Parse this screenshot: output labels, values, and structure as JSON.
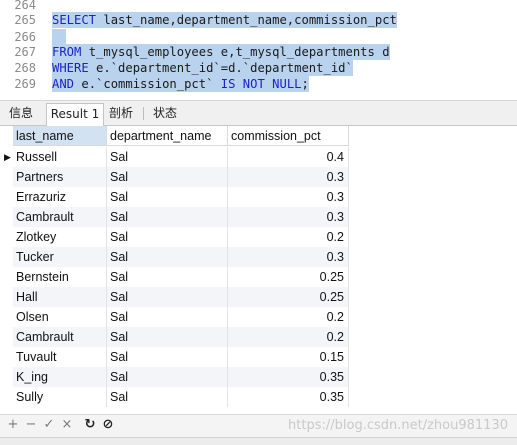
{
  "editor": {
    "lines": [
      {
        "num": "264",
        "code": ""
      },
      {
        "num": "265",
        "code": "SELECT last_name,department_name,commission_pct"
      },
      {
        "num": "266",
        "code": ""
      },
      {
        "num": "267",
        "code": "FROM t_mysql_employees e,t_mysql_departments d"
      },
      {
        "num": "268",
        "code": "WHERE e.`department_id`=d.`department_id`"
      },
      {
        "num": "269",
        "code": "AND e.`commission_pct` IS NOT NULL;"
      }
    ]
  },
  "tabs": [
    {
      "label": "信息",
      "active": false
    },
    {
      "label": "Result 1",
      "active": true
    },
    {
      "label": "剖析",
      "active": false
    },
    {
      "label": "状态",
      "active": false
    }
  ],
  "grid": {
    "columns": [
      "last_name",
      "department_name",
      "commission_pct"
    ],
    "rows": [
      [
        "Russell",
        "Sal",
        "0.4"
      ],
      [
        "Partners",
        "Sal",
        "0.3"
      ],
      [
        "Errazuriz",
        "Sal",
        "0.3"
      ],
      [
        "Cambrault",
        "Sal",
        "0.3"
      ],
      [
        "Zlotkey",
        "Sal",
        "0.2"
      ],
      [
        "Tucker",
        "Sal",
        "0.3"
      ],
      [
        "Bernstein",
        "Sal",
        "0.25"
      ],
      [
        "Hall",
        "Sal",
        "0.25"
      ],
      [
        "Olsen",
        "Sal",
        "0.2"
      ],
      [
        "Cambrault",
        "Sal",
        "0.2"
      ],
      [
        "Tuvault",
        "Sal",
        "0.15"
      ],
      [
        "K_ing",
        "Sal",
        "0.35"
      ],
      [
        "Sully",
        "Sal",
        "0.35"
      ]
    ],
    "current_row_marker": "▶"
  },
  "toolbar": {
    "add": "+",
    "delete": "−",
    "apply": "✓",
    "cancel": "×",
    "refresh": "↻",
    "stop": "⊘",
    "watermark": "https://blog.csdn.net/zhou981130"
  },
  "colors": {
    "selection": "#b9d3ee",
    "keyword": "#1c23c4",
    "header_active": "#d3e2f3"
  }
}
